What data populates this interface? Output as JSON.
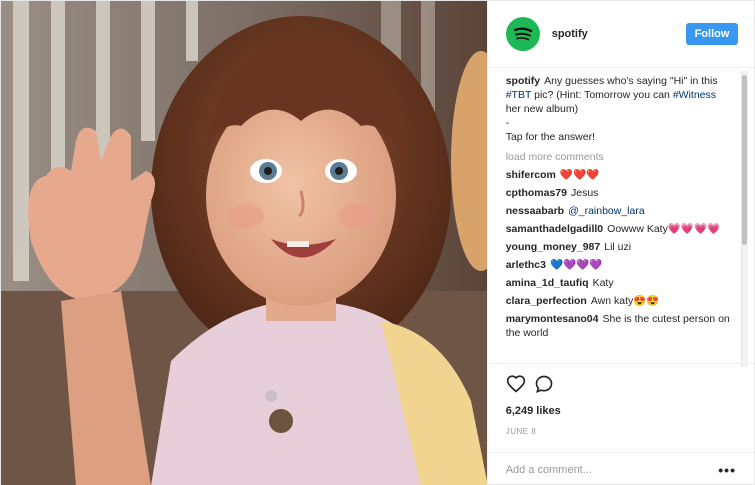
{
  "post": {
    "username": "spotify",
    "follow_label": "Follow",
    "caption": {
      "user": "spotify",
      "text_before_tag1": "Any guesses who's saying \"Hi\" in this ",
      "tag1": "#TBT",
      "text_between": " pic? (Hint: Tomorrow you can ",
      "tag2": "#Witness",
      "text_after": " her new album)",
      "dash": "-",
      "tap": "Tap for the answer!"
    },
    "load_more": "load more comments",
    "comments": [
      {
        "user": "shifercom",
        "text": "❤️❤️❤️"
      },
      {
        "user": "cpthomas79",
        "text": "Jesus"
      },
      {
        "user": "nessaabarb",
        "text": "@_rainbow_lara",
        "link": true
      },
      {
        "user": "samanthadelgadill0",
        "text": "Oowww Katy💗💗💗💗"
      },
      {
        "user": "young_money_987",
        "text": "Lil uzi"
      },
      {
        "user": "arlethc3",
        "text": "💙💜💜💜"
      },
      {
        "user": "amina_1d_taufiq",
        "text": "Katy"
      },
      {
        "user": "clara_perfection",
        "text": "Awn katy😍😍"
      },
      {
        "user": "marymontesano04",
        "text": "She is the cutest person on the world"
      }
    ],
    "likes": "6,249 likes",
    "date": "JUNE 8",
    "add_comment_placeholder": "Add a comment...",
    "more_options": "•••",
    "colors": {
      "follow": "#3897f0",
      "spotify_green": "#1db954",
      "link": "#003569"
    },
    "icons": [
      "heart-icon",
      "comment-icon",
      "spotify-logo-icon",
      "more-options-icon"
    ]
  }
}
